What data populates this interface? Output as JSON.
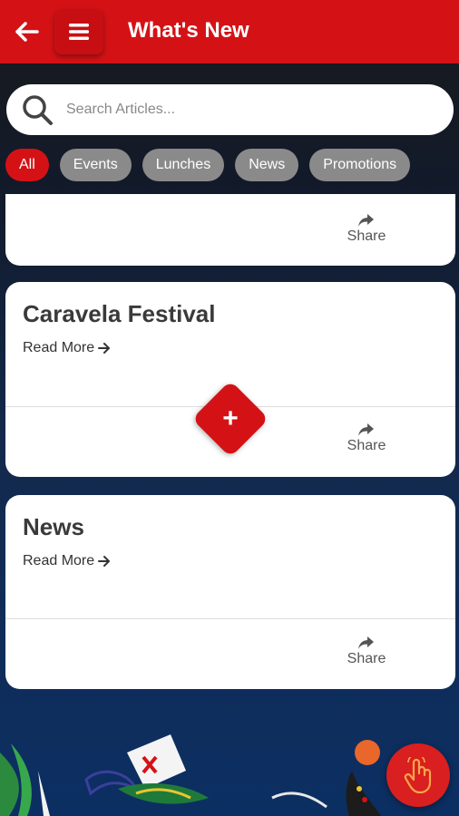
{
  "header": {
    "title": "What's New",
    "back_icon": "arrow-left-icon",
    "menu_icon": "hamburger-menu-icon"
  },
  "search": {
    "placeholder": "Search Articles...",
    "value": "",
    "icon": "search-icon"
  },
  "filters": [
    {
      "label": "All",
      "active": true
    },
    {
      "label": "Events",
      "active": false
    },
    {
      "label": "Lunches",
      "active": false
    },
    {
      "label": "News",
      "active": false
    },
    {
      "label": "Promotions",
      "active": false
    }
  ],
  "articles": [
    {
      "title": "",
      "read_more": "",
      "share": "Share"
    },
    {
      "title": "Caravela Festival",
      "read_more": "Read More",
      "share": "Share"
    },
    {
      "title": "News",
      "read_more": "Read More",
      "share": "Share"
    }
  ],
  "add_button": {
    "label": "+"
  },
  "colors": {
    "accent": "#d41216",
    "chip_inactive": "#8a8a8a",
    "background_dark": "#0c2f63"
  },
  "icons": {
    "share": "share-arrow-icon",
    "read_more_arrow": "arrow-right-icon",
    "touch": "tap-hand-icon"
  }
}
